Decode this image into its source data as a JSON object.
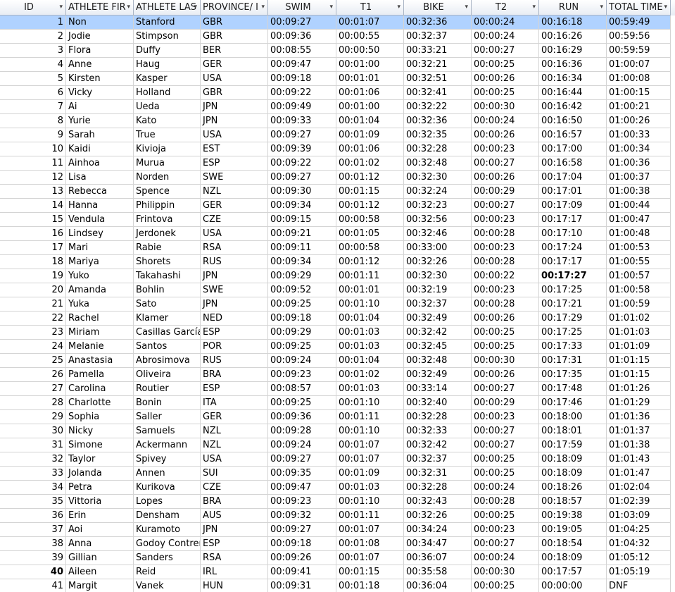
{
  "table": {
    "columns": [
      {
        "key": "id",
        "label": "ID",
        "width": 94
      },
      {
        "key": "first",
        "label": "ATHLETE FIR",
        "width": 96
      },
      {
        "key": "last",
        "label": "ATHLETE LAS",
        "width": 95
      },
      {
        "key": "prov",
        "label": "PROVINCE/ I",
        "width": 96
      },
      {
        "key": "swim",
        "label": "SWIM",
        "width": 97
      },
      {
        "key": "t1",
        "label": "T1",
        "width": 96
      },
      {
        "key": "bike",
        "label": "BIKE",
        "width": 96
      },
      {
        "key": "t2",
        "label": "T2",
        "width": 96
      },
      {
        "key": "run",
        "label": "RUN",
        "width": 96
      },
      {
        "key": "total",
        "label": "TOTAL TIME",
        "width": 91
      }
    ],
    "sort_arrow": "▾",
    "selected_row": 0,
    "rows": [
      {
        "id": "1",
        "first": "Non",
        "last": "Stanford",
        "prov": "GBR",
        "swim": "00:09:27",
        "t1": "00:01:07",
        "bike": "00:32:36",
        "t2": "00:00:24",
        "run": "00:16:18",
        "total": "00:59:49"
      },
      {
        "id": "2",
        "first": "Jodie",
        "last": "Stimpson",
        "prov": "GBR",
        "swim": "00:09:36",
        "t1": "00:00:55",
        "bike": "00:32:37",
        "t2": "00:00:24",
        "run": "00:16:26",
        "total": "00:59:56"
      },
      {
        "id": "3",
        "first": "Flora",
        "last": "Duffy",
        "prov": "BER",
        "swim": "00:08:55",
        "t1": "00:00:50",
        "bike": "00:33:21",
        "t2": "00:00:27",
        "run": "00:16:29",
        "total": "00:59:59"
      },
      {
        "id": "4",
        "first": "Anne",
        "last": "Haug",
        "prov": "GER",
        "swim": "00:09:47",
        "t1": "00:01:00",
        "bike": "00:32:21",
        "t2": "00:00:25",
        "run": "00:16:36",
        "total": "01:00:07"
      },
      {
        "id": "5",
        "first": "Kirsten",
        "last": "Kasper",
        "prov": "USA",
        "swim": "00:09:18",
        "t1": "00:01:01",
        "bike": "00:32:51",
        "t2": "00:00:26",
        "run": "00:16:34",
        "total": "01:00:08"
      },
      {
        "id": "6",
        "first": "Vicky",
        "last": "Holland",
        "prov": "GBR",
        "swim": "00:09:22",
        "t1": "00:01:06",
        "bike": "00:32:41",
        "t2": "00:00:25",
        "run": "00:16:44",
        "total": "01:00:15"
      },
      {
        "id": "7",
        "first": "Ai",
        "last": "Ueda",
        "prov": "JPN",
        "swim": "00:09:49",
        "t1": "00:01:00",
        "bike": "00:32:22",
        "t2": "00:00:30",
        "run": "00:16:42",
        "total": "01:00:21"
      },
      {
        "id": "8",
        "first": "Yurie",
        "last": "Kato",
        "prov": "JPN",
        "swim": "00:09:33",
        "t1": "00:01:04",
        "bike": "00:32:36",
        "t2": "00:00:24",
        "run": "00:16:50",
        "total": "01:00:26"
      },
      {
        "id": "9",
        "first": "Sarah",
        "last": "True",
        "prov": "USA",
        "swim": "00:09:27",
        "t1": "00:01:09",
        "bike": "00:32:35",
        "t2": "00:00:26",
        "run": "00:16:57",
        "total": "01:00:33"
      },
      {
        "id": "10",
        "first": "Kaidi",
        "last": "Kivioja",
        "prov": "EST",
        "swim": "00:09:39",
        "t1": "00:01:06",
        "bike": "00:32:28",
        "t2": "00:00:23",
        "run": "00:17:00",
        "total": "01:00:34"
      },
      {
        "id": "11",
        "first": "Ainhoa",
        "last": "Murua",
        "prov": "ESP",
        "swim": "00:09:22",
        "t1": "00:01:02",
        "bike": "00:32:48",
        "t2": "00:00:27",
        "run": "00:16:58",
        "total": "01:00:36"
      },
      {
        "id": "12",
        "first": "Lisa",
        "last": "Norden",
        "prov": "SWE",
        "swim": "00:09:27",
        "t1": "00:01:12",
        "bike": "00:32:30",
        "t2": "00:00:26",
        "run": "00:17:04",
        "total": "01:00:37"
      },
      {
        "id": "13",
        "first": "Rebecca",
        "last": "Spence",
        "prov": "NZL",
        "swim": "00:09:30",
        "t1": "00:01:15",
        "bike": "00:32:24",
        "t2": "00:00:29",
        "run": "00:17:01",
        "total": "01:00:38"
      },
      {
        "id": "14",
        "first": "Hanna",
        "last": "Philippin",
        "prov": "GER",
        "swim": "00:09:34",
        "t1": "00:01:12",
        "bike": "00:32:23",
        "t2": "00:00:27",
        "run": "00:17:09",
        "total": "01:00:44"
      },
      {
        "id": "15",
        "first": "Vendula",
        "last": "Frintova",
        "prov": "CZE",
        "swim": "00:09:15",
        "t1": "00:00:58",
        "bike": "00:32:56",
        "t2": "00:00:23",
        "run": "00:17:17",
        "total": "01:00:47"
      },
      {
        "id": "16",
        "first": "Lindsey",
        "last": "Jerdonek",
        "prov": "USA",
        "swim": "00:09:21",
        "t1": "00:01:05",
        "bike": "00:32:46",
        "t2": "00:00:28",
        "run": "00:17:10",
        "total": "01:00:48"
      },
      {
        "id": "17",
        "first": "Mari",
        "last": "Rabie",
        "prov": "RSA",
        "swim": "00:09:11",
        "t1": "00:00:58",
        "bike": "00:33:00",
        "t2": "00:00:23",
        "run": "00:17:24",
        "total": "01:00:53"
      },
      {
        "id": "18",
        "first": "Mariya",
        "last": "Shorets",
        "prov": "RUS",
        "swim": "00:09:34",
        "t1": "00:01:12",
        "bike": "00:32:26",
        "t2": "00:00:28",
        "run": "00:17:17",
        "total": "01:00:55"
      },
      {
        "id": "19",
        "first": "Yuko",
        "last": "Takahashi",
        "prov": "JPN",
        "swim": "00:09:29",
        "t1": "00:01:11",
        "bike": "00:32:30",
        "t2": "00:00:22",
        "run": "00:17:27",
        "total": "01:00:57",
        "bold_run": true
      },
      {
        "id": "20",
        "first": "Amanda",
        "last": "Bohlin",
        "prov": "SWE",
        "swim": "00:09:52",
        "t1": "00:01:01",
        "bike": "00:32:19",
        "t2": "00:00:23",
        "run": "00:17:25",
        "total": "01:00:58"
      },
      {
        "id": "21",
        "first": "Yuka",
        "last": "Sato",
        "prov": "JPN",
        "swim": "00:09:25",
        "t1": "00:01:10",
        "bike": "00:32:37",
        "t2": "00:00:28",
        "run": "00:17:21",
        "total": "01:00:59"
      },
      {
        "id": "22",
        "first": "Rachel",
        "last": "Klamer",
        "prov": "NED",
        "swim": "00:09:18",
        "t1": "00:01:04",
        "bike": "00:32:49",
        "t2": "00:00:26",
        "run": "00:17:29",
        "total": "01:01:02"
      },
      {
        "id": "23",
        "first": "Miriam",
        "last": "Casillas García",
        "prov": "ESP",
        "swim": "00:09:29",
        "t1": "00:01:03",
        "bike": "00:32:42",
        "t2": "00:00:25",
        "run": "00:17:25",
        "total": "01:01:03"
      },
      {
        "id": "24",
        "first": "Melanie",
        "last": "Santos",
        "prov": "POR",
        "swim": "00:09:25",
        "t1": "00:01:03",
        "bike": "00:32:45",
        "t2": "00:00:25",
        "run": "00:17:33",
        "total": "01:01:09"
      },
      {
        "id": "25",
        "first": "Anastasia",
        "last": "Abrosimova",
        "prov": "RUS",
        "swim": "00:09:24",
        "t1": "00:01:04",
        "bike": "00:32:48",
        "t2": "00:00:30",
        "run": "00:17:31",
        "total": "01:01:15"
      },
      {
        "id": "26",
        "first": "Pamella",
        "last": "Oliveira",
        "prov": "BRA",
        "swim": "00:09:23",
        "t1": "00:01:02",
        "bike": "00:32:49",
        "t2": "00:00:26",
        "run": "00:17:35",
        "total": "01:01:15"
      },
      {
        "id": "27",
        "first": "Carolina",
        "last": "Routier",
        "prov": "ESP",
        "swim": "00:08:57",
        "t1": "00:01:03",
        "bike": "00:33:14",
        "t2": "00:00:27",
        "run": "00:17:48",
        "total": "01:01:26"
      },
      {
        "id": "28",
        "first": "Charlotte",
        "last": "Bonin",
        "prov": "ITA",
        "swim": "00:09:25",
        "t1": "00:01:10",
        "bike": "00:32:40",
        "t2": "00:00:29",
        "run": "00:17:46",
        "total": "01:01:29"
      },
      {
        "id": "29",
        "first": "Sophia",
        "last": "Saller",
        "prov": "GER",
        "swim": "00:09:36",
        "t1": "00:01:11",
        "bike": "00:32:28",
        "t2": "00:00:23",
        "run": "00:18:00",
        "total": "01:01:36"
      },
      {
        "id": "30",
        "first": "Nicky",
        "last": "Samuels",
        "prov": "NZL",
        "swim": "00:09:28",
        "t1": "00:01:10",
        "bike": "00:32:33",
        "t2": "00:00:27",
        "run": "00:18:01",
        "total": "01:01:37"
      },
      {
        "id": "31",
        "first": "Simone",
        "last": "Ackermann",
        "prov": "NZL",
        "swim": "00:09:24",
        "t1": "00:01:07",
        "bike": "00:32:42",
        "t2": "00:00:27",
        "run": "00:17:59",
        "total": "01:01:38"
      },
      {
        "id": "32",
        "first": "Taylor",
        "last": "Spivey",
        "prov": "USA",
        "swim": "00:09:27",
        "t1": "00:01:07",
        "bike": "00:32:37",
        "t2": "00:00:25",
        "run": "00:18:09",
        "total": "01:01:43"
      },
      {
        "id": "33",
        "first": "Jolanda",
        "last": "Annen",
        "prov": "SUI",
        "swim": "00:09:35",
        "t1": "00:01:09",
        "bike": "00:32:31",
        "t2": "00:00:25",
        "run": "00:18:09",
        "total": "01:01:47"
      },
      {
        "id": "34",
        "first": "Petra",
        "last": "Kurikova",
        "prov": "CZE",
        "swim": "00:09:47",
        "t1": "00:01:03",
        "bike": "00:32:28",
        "t2": "00:00:24",
        "run": "00:18:26",
        "total": "01:02:04"
      },
      {
        "id": "35",
        "first": "Vittoria",
        "last": "Lopes",
        "prov": "BRA",
        "swim": "00:09:23",
        "t1": "00:01:10",
        "bike": "00:32:43",
        "t2": "00:00:28",
        "run": "00:18:57",
        "total": "01:02:39"
      },
      {
        "id": "36",
        "first": "Erin",
        "last": "Densham",
        "prov": "AUS",
        "swim": "00:09:32",
        "t1": "00:01:11",
        "bike": "00:32:26",
        "t2": "00:00:25",
        "run": "00:19:38",
        "total": "01:03:09"
      },
      {
        "id": "37",
        "first": "Aoi",
        "last": "Kuramoto",
        "prov": "JPN",
        "swim": "00:09:27",
        "t1": "00:01:07",
        "bike": "00:34:24",
        "t2": "00:00:23",
        "run": "00:19:05",
        "total": "01:04:25"
      },
      {
        "id": "38",
        "first": "Anna",
        "last": "Godoy Contrer",
        "prov": "ESP",
        "swim": "00:09:18",
        "t1": "00:01:08",
        "bike": "00:34:47",
        "t2": "00:00:27",
        "run": "00:18:54",
        "total": "01:04:32"
      },
      {
        "id": "39",
        "first": "Gillian",
        "last": "Sanders",
        "prov": "RSA",
        "swim": "00:09:26",
        "t1": "00:01:07",
        "bike": "00:36:07",
        "t2": "00:00:24",
        "run": "00:18:09",
        "total": "01:05:12"
      },
      {
        "id": "40",
        "first": "Aileen",
        "last": "Reid",
        "prov": "IRL",
        "swim": "00:09:41",
        "t1": "00:01:15",
        "bike": "00:35:58",
        "t2": "00:00:30",
        "run": "00:17:57",
        "total": "01:05:19",
        "bold_id": true
      },
      {
        "id": "41",
        "first": "Margit",
        "last": "Vanek",
        "prov": "HUN",
        "swim": "00:09:31",
        "t1": "00:01:18",
        "bike": "00:36:04",
        "t2": "00:00:25",
        "run": "00:00:00",
        "total": "DNF"
      }
    ]
  }
}
